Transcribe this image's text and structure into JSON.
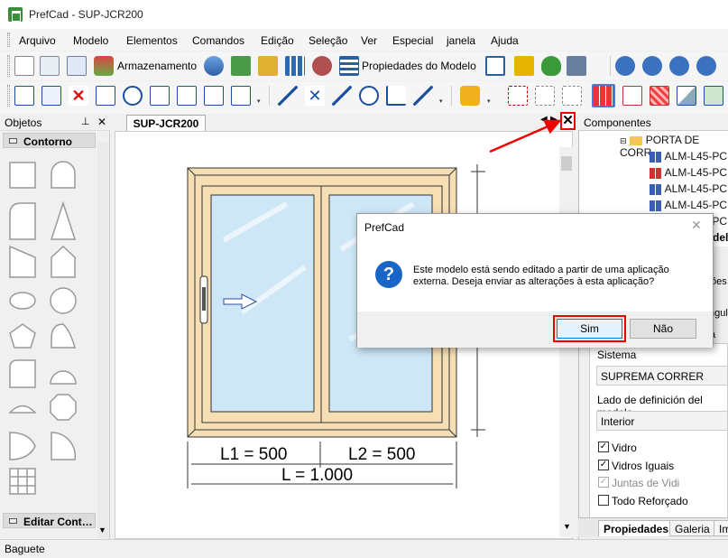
{
  "window": {
    "title": "PrefCad - SUP-JCR200"
  },
  "menu": [
    "Arquivo",
    "Modelo",
    "Elementos",
    "Comandos",
    "Edição",
    "Seleção",
    "Ver",
    "Especial",
    "janela",
    "Ajuda"
  ],
  "toolbar1": {
    "storage_label": "Armazenamento",
    "model_props_label": "Propiedades do Modelo"
  },
  "objects_panel": {
    "title": "Objetos",
    "section_contorno": "Contorno",
    "section_editar": "Editar Cont…"
  },
  "document": {
    "tab": "SUP-JCR200",
    "dim_l1": "L1 = 500",
    "dim_l2": "L2 = 500",
    "dim_total": "L = 1.000"
  },
  "components_panel": {
    "title": "Componentes",
    "tree": [
      {
        "label": "PORTA DE CORR",
        "icon": "folder-icon"
      },
      {
        "label": "ALM-L45-PC",
        "icon": "frame-blue-icon"
      },
      {
        "label": "ALM-L45-PC",
        "icon": "frame-red-icon"
      },
      {
        "label": "ALM-L45-PC",
        "icon": "frame-blue-icon"
      },
      {
        "label": "ALM-L45-PC",
        "icon": "frame-blue-icon"
      },
      {
        "label": "ALM-L45-PC",
        "icon": "frame-blue-icon"
      }
    ],
    "frag_delo": "delo",
    "frag_oes": "ões",
    "frag_ngulo": "ngulo",
    "frag_a": "a",
    "sistema_label": "Sistema",
    "sistema_value": "SUPREMA CORRER",
    "lado_label": "Lado de definición del modelo",
    "lado_value": "Interior",
    "checks": [
      {
        "label": "Vidro",
        "checked": true,
        "disabled": false
      },
      {
        "label": "Vidros Iguais",
        "checked": true,
        "disabled": false
      },
      {
        "label": "Juntas de Vidi",
        "checked": true,
        "disabled": true
      },
      {
        "label": "Todo Reforçado",
        "checked": false,
        "disabled": false
      }
    ],
    "tabs": [
      "Propiedades",
      "Galeria",
      "Im"
    ]
  },
  "dialog": {
    "title": "PrefCad",
    "message": "Este modelo está sendo editado a partir de uma aplicação externa. Deseja enviar as alterações à esta aplicação?",
    "yes": "Sim",
    "no": "Não"
  },
  "status": {
    "text": "Baguete"
  },
  "colors": {
    "frame": "#f6dfb4",
    "glass": "#cde7f7",
    "highlight": "#e00000",
    "accent": "#0078d7"
  }
}
